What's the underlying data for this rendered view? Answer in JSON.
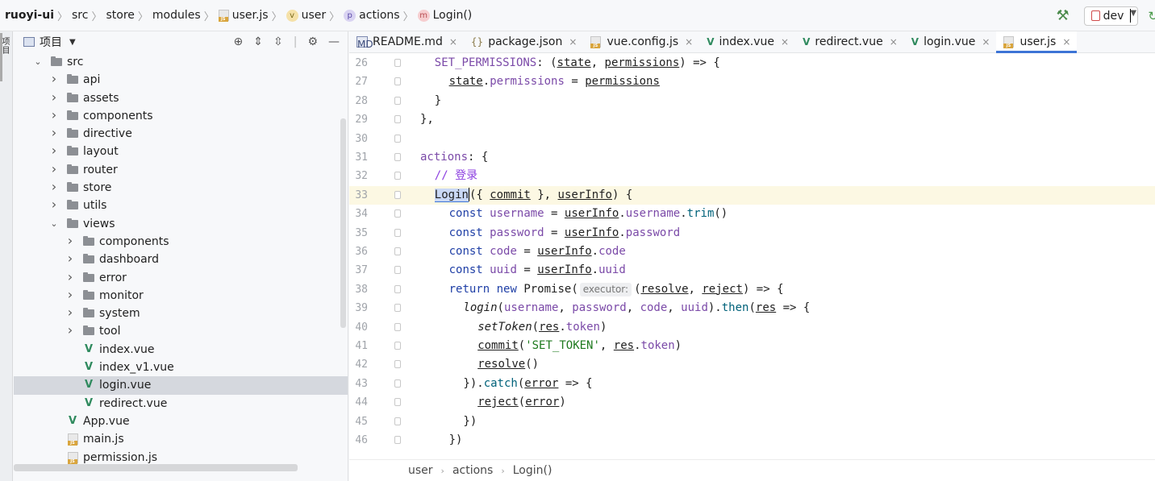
{
  "navbar": {
    "root": "ruoyi-ui",
    "crumbs": [
      "src",
      "store",
      "modules",
      "user.js",
      "user",
      "actions",
      "Login()"
    ],
    "icons": {
      "user_js": "js-file-icon",
      "user": "v",
      "actions": "p",
      "login": "m"
    },
    "branch": "dev"
  },
  "toolstrip": {
    "tab_label": "项目"
  },
  "project": {
    "title": "项目",
    "tree": [
      {
        "label": "src",
        "type": "folder",
        "depth": 0,
        "expanded": true
      },
      {
        "label": "api",
        "type": "folder",
        "depth": 1
      },
      {
        "label": "assets",
        "type": "folder",
        "depth": 1
      },
      {
        "label": "components",
        "type": "folder",
        "depth": 1
      },
      {
        "label": "directive",
        "type": "folder",
        "depth": 1
      },
      {
        "label": "layout",
        "type": "folder",
        "depth": 1
      },
      {
        "label": "router",
        "type": "folder",
        "depth": 1
      },
      {
        "label": "store",
        "type": "folder",
        "depth": 1
      },
      {
        "label": "utils",
        "type": "folder",
        "depth": 1
      },
      {
        "label": "views",
        "type": "folder",
        "depth": 1,
        "expanded": true
      },
      {
        "label": "components",
        "type": "folder",
        "depth": 2
      },
      {
        "label": "dashboard",
        "type": "folder",
        "depth": 2
      },
      {
        "label": "error",
        "type": "folder",
        "depth": 2
      },
      {
        "label": "monitor",
        "type": "folder",
        "depth": 2
      },
      {
        "label": "system",
        "type": "folder",
        "depth": 2
      },
      {
        "label": "tool",
        "type": "folder",
        "depth": 2
      },
      {
        "label": "index.vue",
        "type": "vue",
        "depth": 2
      },
      {
        "label": "index_v1.vue",
        "type": "vue",
        "depth": 2
      },
      {
        "label": "login.vue",
        "type": "vue",
        "depth": 2,
        "selected": true
      },
      {
        "label": "redirect.vue",
        "type": "vue",
        "depth": 2
      },
      {
        "label": "App.vue",
        "type": "vue",
        "depth": 1
      },
      {
        "label": "main.js",
        "type": "js",
        "depth": 1
      },
      {
        "label": "permission.js",
        "type": "js",
        "depth": 1
      }
    ]
  },
  "tabs": [
    {
      "label": "README.md",
      "icon": "md"
    },
    {
      "label": "package.json",
      "icon": "json"
    },
    {
      "label": "vue.config.js",
      "icon": "js"
    },
    {
      "label": "index.vue",
      "icon": "vue"
    },
    {
      "label": "redirect.vue",
      "icon": "vue"
    },
    {
      "label": "login.vue",
      "icon": "vue"
    },
    {
      "label": "user.js",
      "icon": "js",
      "active": true
    }
  ],
  "editor": {
    "current_line": 33,
    "lines": [
      {
        "n": 26,
        "indent": 1,
        "tokens": [
          [
            "prop",
            "SET_PERMISSIONS"
          ],
          [
            "pl",
            ": ("
          ],
          [
            "pl ul",
            "state"
          ],
          [
            "pl",
            ", "
          ],
          [
            "pl ul",
            "permissions"
          ],
          [
            "pl",
            ") => {"
          ]
        ]
      },
      {
        "n": 27,
        "indent": 2,
        "tokens": [
          [
            "pl ul",
            "state"
          ],
          [
            "pl",
            "."
          ],
          [
            "prop",
            "permissions"
          ],
          [
            "pl",
            " = "
          ],
          [
            "pl ul",
            "permissions"
          ]
        ]
      },
      {
        "n": 28,
        "indent": 1,
        "tokens": [
          [
            "pl",
            "}"
          ]
        ]
      },
      {
        "n": 29,
        "indent": 0,
        "tokens": [
          [
            "pl",
            "},"
          ]
        ]
      },
      {
        "n": 30,
        "indent": 0,
        "tokens": []
      },
      {
        "n": 31,
        "indent": 0,
        "tokens": [
          [
            "prop",
            "actions"
          ],
          [
            "pl",
            ": {"
          ]
        ]
      },
      {
        "n": 32,
        "indent": 1,
        "tokens": [
          [
            "cmt",
            "// 登录"
          ]
        ]
      },
      {
        "n": 33,
        "indent": 1,
        "tokens": [
          [
            "pl hilite",
            "Login"
          ],
          [
            "caret",
            ""
          ],
          [
            "pl",
            "({ "
          ],
          [
            "pl ul",
            "commit"
          ],
          [
            "pl",
            " }, "
          ],
          [
            "pl ul",
            "userInfo"
          ],
          [
            "pl",
            ") {"
          ]
        ]
      },
      {
        "n": 34,
        "indent": 2,
        "tokens": [
          [
            "kw",
            "const "
          ],
          [
            "prop",
            "username"
          ],
          [
            "pl",
            " = "
          ],
          [
            "pl ul",
            "userInfo"
          ],
          [
            "pl",
            "."
          ],
          [
            "prop",
            "username"
          ],
          [
            "pl",
            "."
          ],
          [
            "fn",
            "trim"
          ],
          [
            "pl",
            "()"
          ]
        ]
      },
      {
        "n": 35,
        "indent": 2,
        "tokens": [
          [
            "kw",
            "const "
          ],
          [
            "prop",
            "password"
          ],
          [
            "pl",
            " = "
          ],
          [
            "pl ul",
            "userInfo"
          ],
          [
            "pl",
            "."
          ],
          [
            "prop",
            "password"
          ]
        ]
      },
      {
        "n": 36,
        "indent": 2,
        "tokens": [
          [
            "kw",
            "const "
          ],
          [
            "prop",
            "code"
          ],
          [
            "pl",
            " = "
          ],
          [
            "pl ul",
            "userInfo"
          ],
          [
            "pl",
            "."
          ],
          [
            "prop",
            "code"
          ]
        ]
      },
      {
        "n": 37,
        "indent": 2,
        "tokens": [
          [
            "kw",
            "const "
          ],
          [
            "prop",
            "uuid"
          ],
          [
            "pl",
            " = "
          ],
          [
            "pl ul",
            "userInfo"
          ],
          [
            "pl",
            "."
          ],
          [
            "prop",
            "uuid"
          ]
        ]
      },
      {
        "n": 38,
        "indent": 2,
        "tokens": [
          [
            "kw",
            "return new "
          ],
          [
            "pl",
            "Promise("
          ],
          [
            "hint",
            "executor:"
          ],
          [
            "pl",
            "("
          ],
          [
            "pl ul",
            "resolve"
          ],
          [
            "pl",
            ", "
          ],
          [
            "pl ul",
            "reject"
          ],
          [
            "pl",
            ") => {"
          ]
        ]
      },
      {
        "n": 39,
        "indent": 3,
        "tokens": [
          [
            "pl it",
            "login"
          ],
          [
            "pl",
            "("
          ],
          [
            "prop",
            "username"
          ],
          [
            "pl",
            ", "
          ],
          [
            "prop",
            "password"
          ],
          [
            "pl",
            ", "
          ],
          [
            "prop",
            "code"
          ],
          [
            "pl",
            ", "
          ],
          [
            "prop",
            "uuid"
          ],
          [
            "pl",
            ")."
          ],
          [
            "fn",
            "then"
          ],
          [
            "pl",
            "("
          ],
          [
            "pl ul",
            "res"
          ],
          [
            "pl",
            " => {"
          ]
        ]
      },
      {
        "n": 40,
        "indent": 4,
        "tokens": [
          [
            "pl it",
            "setToken"
          ],
          [
            "pl",
            "("
          ],
          [
            "pl ul",
            "res"
          ],
          [
            "pl",
            "."
          ],
          [
            "prop",
            "token"
          ],
          [
            "pl",
            ")"
          ]
        ]
      },
      {
        "n": 41,
        "indent": 4,
        "tokens": [
          [
            "pl ul",
            "commit"
          ],
          [
            "pl",
            "("
          ],
          [
            "str",
            "'SET_TOKEN'"
          ],
          [
            "pl",
            ", "
          ],
          [
            "pl ul",
            "res"
          ],
          [
            "pl",
            "."
          ],
          [
            "prop",
            "token"
          ],
          [
            "pl",
            ")"
          ]
        ]
      },
      {
        "n": 42,
        "indent": 4,
        "tokens": [
          [
            "pl ul",
            "resolve"
          ],
          [
            "pl",
            "()"
          ]
        ]
      },
      {
        "n": 43,
        "indent": 3,
        "tokens": [
          [
            "pl",
            "})."
          ],
          [
            "fn",
            "catch"
          ],
          [
            "pl",
            "("
          ],
          [
            "pl ul",
            "error"
          ],
          [
            "pl",
            " => {"
          ]
        ]
      },
      {
        "n": 44,
        "indent": 4,
        "tokens": [
          [
            "pl ul",
            "reject"
          ],
          [
            "pl",
            "("
          ],
          [
            "pl ul",
            "error"
          ],
          [
            "pl",
            ")"
          ]
        ]
      },
      {
        "n": 45,
        "indent": 3,
        "tokens": [
          [
            "pl",
            "})"
          ]
        ]
      },
      {
        "n": 46,
        "indent": 2,
        "tokens": [
          [
            "pl",
            "})"
          ]
        ]
      }
    ]
  },
  "edit_crumbs": [
    "user",
    "actions",
    "Login()"
  ],
  "colors": {
    "accent": "#3d74d6",
    "current_line": "#fcf8e3",
    "selection": "#d5d8de"
  }
}
